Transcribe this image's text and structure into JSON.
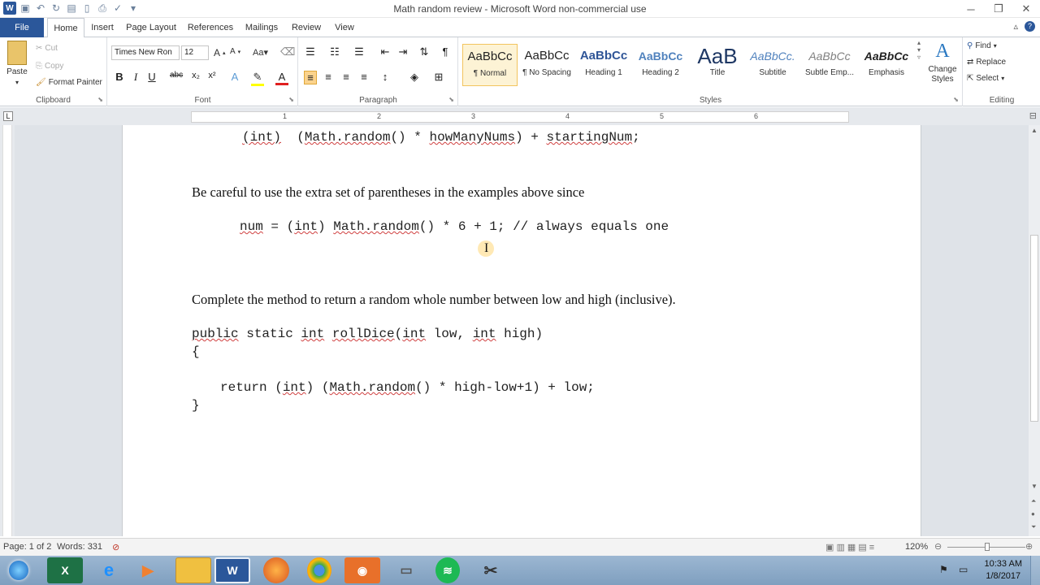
{
  "window": {
    "title": "Math random review - Microsoft Word non-commercial use"
  },
  "ribbon_tabs": [
    "File",
    "Home",
    "Insert",
    "Page Layout",
    "References",
    "Mailings",
    "Review",
    "View"
  ],
  "clipboard": {
    "paste": "Paste",
    "cut": "Cut",
    "copy": "Copy",
    "format_painter": "Format Painter",
    "label": "Clipboard"
  },
  "font": {
    "name": "Times New Ron",
    "size": "12",
    "label": "Font"
  },
  "paragraph": {
    "label": "Paragraph"
  },
  "styles": {
    "items": [
      {
        "preview": "AaBbCc",
        "name": "¶ Normal"
      },
      {
        "preview": "AaBbCc",
        "name": "¶ No Spacing"
      },
      {
        "preview": "AaBbCc",
        "name": "Heading 1"
      },
      {
        "preview": "AaBbCc",
        "name": "Heading 2"
      },
      {
        "preview": "AaB",
        "name": "Title"
      },
      {
        "preview": "AaBbCc.",
        "name": "Subtitle"
      },
      {
        "preview": "AaBbCc",
        "name": "Subtle Emp..."
      },
      {
        "preview": "AaBbCc",
        "name": "Emphasis"
      }
    ],
    "change_styles": "Change Styles",
    "label": "Styles"
  },
  "editing": {
    "find": "Find",
    "replace": "Replace",
    "select": "Select",
    "label": "Editing"
  },
  "ruler_numbers": [
    "1",
    "2",
    "3",
    "4",
    "5",
    "6"
  ],
  "document": {
    "code1": "(int)  (Math.random() * howManyNums) + startingNum;",
    "para1": "Be careful to use the extra set of parentheses in the examples above since",
    "code2": "num = (int) Math.random() * 6 + 1; // always equals one",
    "para2": "Complete the method to return a random whole number between low and high (inclusive).",
    "code3": "public static int rollDice(int low, int high)",
    "code4": "{",
    "code5": "return (int) (Math.random() * high-low+1) + low;",
    "code6": "}"
  },
  "status": {
    "page": "Page: 1 of 2",
    "words": "Words: 331",
    "zoom": "120%"
  },
  "clock": {
    "time": "10:33 AM",
    "date": "1/8/2017"
  },
  "colors": {
    "accent": "#2b579a",
    "squiggle": "#d04040",
    "taskbar": "#8eabc9"
  }
}
